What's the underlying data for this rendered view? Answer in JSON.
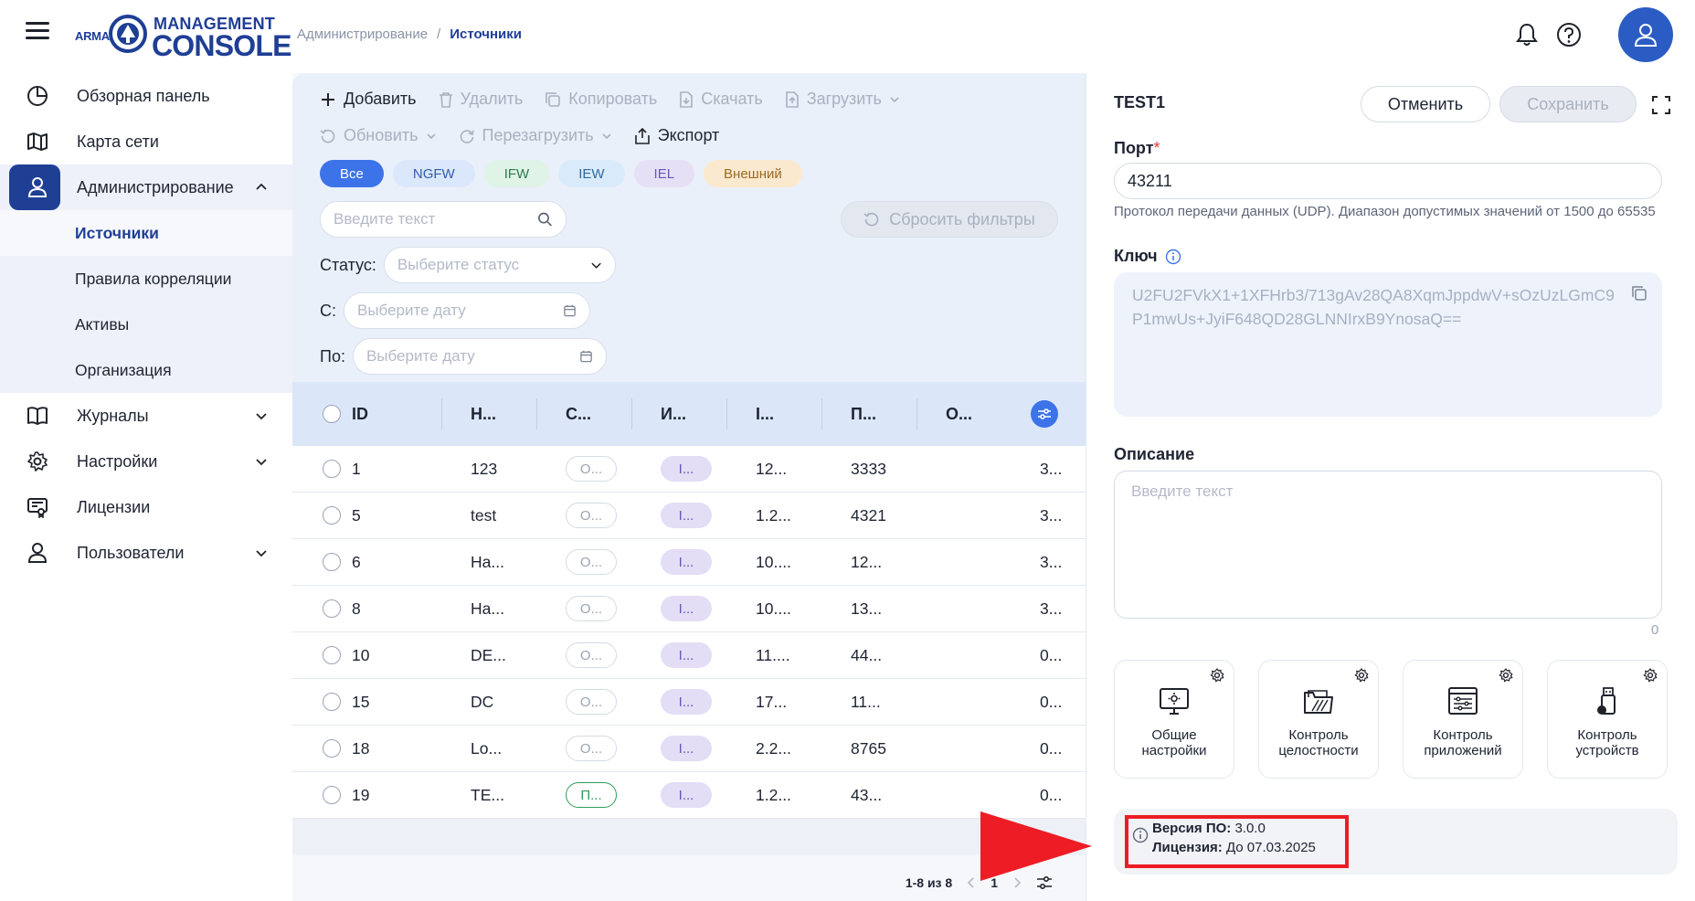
{
  "header": {
    "logo_small": "ARMA",
    "logo_top": "MANAGEMENT",
    "logo_bottom": "CONSOLE",
    "breadcrumb": [
      "Администрирование",
      "Источники"
    ],
    "breadcrumb_sep": "/"
  },
  "sidebar": {
    "items": [
      {
        "label": "Обзорная панель",
        "icon": "dashboard-icon"
      },
      {
        "label": "Карта сети",
        "icon": "map-icon"
      },
      {
        "label": "Администрирование",
        "icon": "admin-user-icon",
        "expanded": true
      },
      {
        "label": "Журналы",
        "icon": "book-icon"
      },
      {
        "label": "Настройки",
        "icon": "gear-icon"
      },
      {
        "label": "Лицензии",
        "icon": "license-icon"
      },
      {
        "label": "Пользователи",
        "icon": "user-icon"
      }
    ],
    "admin_sub": [
      "Источники",
      "Правила корреляции",
      "Активы",
      "Организация"
    ]
  },
  "toolbar": {
    "add": "Добавить",
    "delete": "Удалить",
    "copy": "Копировать",
    "download": "Скачать",
    "upload": "Загрузить",
    "refresh": "Обновить",
    "reload": "Перезагрузить",
    "export": "Экспорт"
  },
  "chips": [
    "Все",
    "NGFW",
    "IFW",
    "IEW",
    "IEL",
    "Внешний"
  ],
  "chip_colors": {
    "all_bg": "#3d73e8",
    "ngfw_bg": "#dbe8fb",
    "ifw_bg": "#dff3e6",
    "iew_bg": "#d9ebfa",
    "iel_bg": "#e6e0f7",
    "ext_bg": "#fbe9cf"
  },
  "filters": {
    "search_placeholder": "Введите текст",
    "reset": "Сбросить фильтры",
    "status_label": "Статус:",
    "status_placeholder": "Выберите статус",
    "from_label": "С:",
    "from_placeholder": "Выберите дату",
    "to_label": "По:",
    "to_placeholder": "Выберите дату"
  },
  "table": {
    "columns": [
      "ID",
      "Н...",
      "С...",
      "И...",
      "I...",
      "П...",
      "О..."
    ],
    "rows": [
      {
        "id": "1",
        "name": "123",
        "status": "О...",
        "type": "I...",
        "ip": "12...",
        "port": "3333",
        "last": "3..."
      },
      {
        "id": "5",
        "name": "test",
        "status": "О...",
        "type": "I...",
        "ip": "1.2...",
        "port": "4321",
        "last": "3..."
      },
      {
        "id": "6",
        "name": "На...",
        "status": "О...",
        "type": "I...",
        "ip": "10....",
        "port": "12...",
        "last": "3..."
      },
      {
        "id": "8",
        "name": "На...",
        "status": "О...",
        "type": "I...",
        "ip": "10....",
        "port": "13...",
        "last": "3..."
      },
      {
        "id": "10",
        "name": "DE...",
        "status": "О...",
        "type": "I...",
        "ip": "11....",
        "port": "44...",
        "last": "0..."
      },
      {
        "id": "15",
        "name": "DC",
        "status": "О...",
        "type": "I...",
        "ip": "17...",
        "port": "11...",
        "last": "0..."
      },
      {
        "id": "18",
        "name": "Lo...",
        "status": "О...",
        "type": "I...",
        "ip": "2.2...",
        "port": "8765",
        "last": "0..."
      },
      {
        "id": "19",
        "name": "TE...",
        "status": "П...",
        "type": "I...",
        "ip": "1.2...",
        "port": "43...",
        "last": "0..."
      }
    ],
    "pager_range": "1-8 из 8",
    "pager_page": "1"
  },
  "detail": {
    "title": "TEST1",
    "cancel": "Отменить",
    "save": "Сохранить",
    "port_label": "Порт",
    "port_required": "*",
    "port_value": "43211",
    "port_hint": "Протокол передачи данных (UDP). Диапазон допустимых значений от 1500 до 65535",
    "key_label": "Ключ",
    "key_value": "U2FU2FVkX1+1XFHrb3/713gAv28QA8XqmJppdwV+sOzUzLGmC9P1mwUs+JyiF648QD28GLNNIrxB9YnosaQ==",
    "description_label": "Описание",
    "description_placeholder": "Введите текст",
    "description_count": "0",
    "modules": [
      {
        "line1": "Общие",
        "line2": "настройки",
        "icon": "monitor-settings-icon"
      },
      {
        "line1": "Контроль",
        "line2": "целостности",
        "icon": "folder-check-icon"
      },
      {
        "line1": "Контроль",
        "line2": "приложений",
        "icon": "app-window-icon"
      },
      {
        "line1": "Контроль",
        "line2": "устройств",
        "icon": "usb-device-icon"
      }
    ],
    "version_label": "Версия ПО:",
    "version_value": "3.0.0",
    "license_label": "Лицензия:",
    "license_value": "До 07.03.2025"
  },
  "annotation_colors": {
    "highlight": "#ee1c25"
  }
}
